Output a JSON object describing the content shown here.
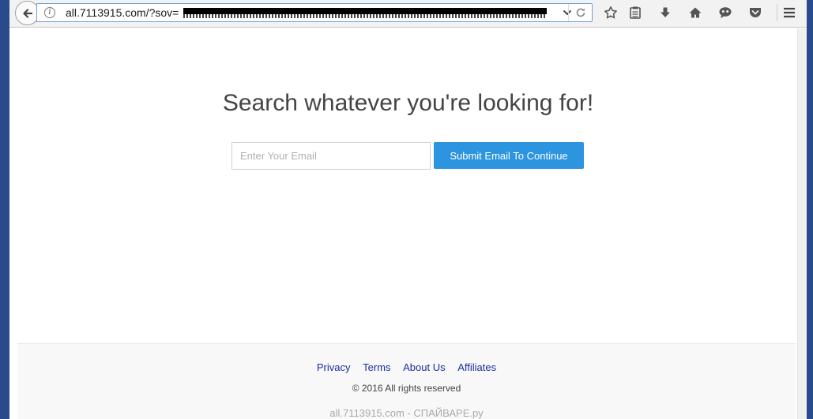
{
  "browser": {
    "url_visible": "all.7113915.com/?sov=",
    "icons": {
      "back": "back-arrow-icon",
      "info": "info-icon",
      "dropdown": "chevron-down-icon",
      "reload": "reload-icon",
      "bookmark": "star-icon",
      "reading_list": "clipboard-icon",
      "downloads": "download-arrow-icon",
      "home": "home-icon",
      "chat": "chat-icon",
      "pocket": "pocket-icon",
      "menu": "hamburger-menu-icon"
    }
  },
  "page": {
    "headline": "Search whatever you're looking for!",
    "email_placeholder": "Enter Your Email",
    "email_value": "",
    "submit_label": "Submit Email To Continue",
    "accent_color": "#2d95e0"
  },
  "footer": {
    "links": [
      "Privacy",
      "Terms",
      "About Us",
      "Affiliates"
    ],
    "copyright": "© 2016 All rights reserved",
    "watermark": "all.7113915.com - СПАЙВАРЕ.ру"
  }
}
